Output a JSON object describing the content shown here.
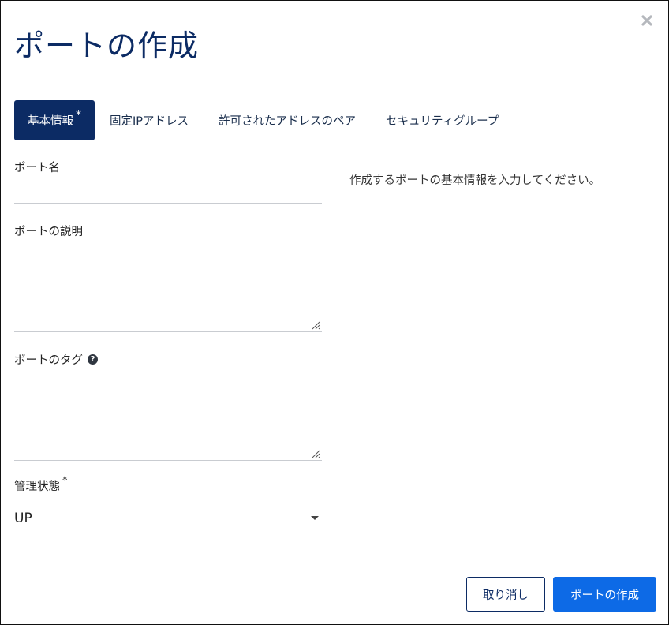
{
  "dialog": {
    "title": "ポートの作成",
    "close_icon": "close-icon"
  },
  "tabs": [
    {
      "label": "基本情報",
      "required_mark": "*",
      "active": true
    },
    {
      "label": "固定IPアドレス"
    },
    {
      "label": "許可されたアドレスのペア"
    },
    {
      "label": "セキュリティグループ"
    }
  ],
  "form": {
    "port_name": {
      "label": "ポート名",
      "value": ""
    },
    "port_description": {
      "label": "ポートの説明",
      "value": ""
    },
    "port_tags": {
      "label": "ポートのタグ",
      "help_icon": "question-circle-icon",
      "value": ""
    },
    "admin_state": {
      "label": "管理状態",
      "required_mark": "*",
      "value": "UP"
    }
  },
  "help_text": "作成するポートの基本情報を入力してください。",
  "footer": {
    "cancel_label": "取り消し",
    "create_label": "ポートの作成"
  },
  "colors": {
    "title": "#0c2b64",
    "active_tab_bg": "#0c2b64",
    "primary_button": "#0d6ae6"
  }
}
